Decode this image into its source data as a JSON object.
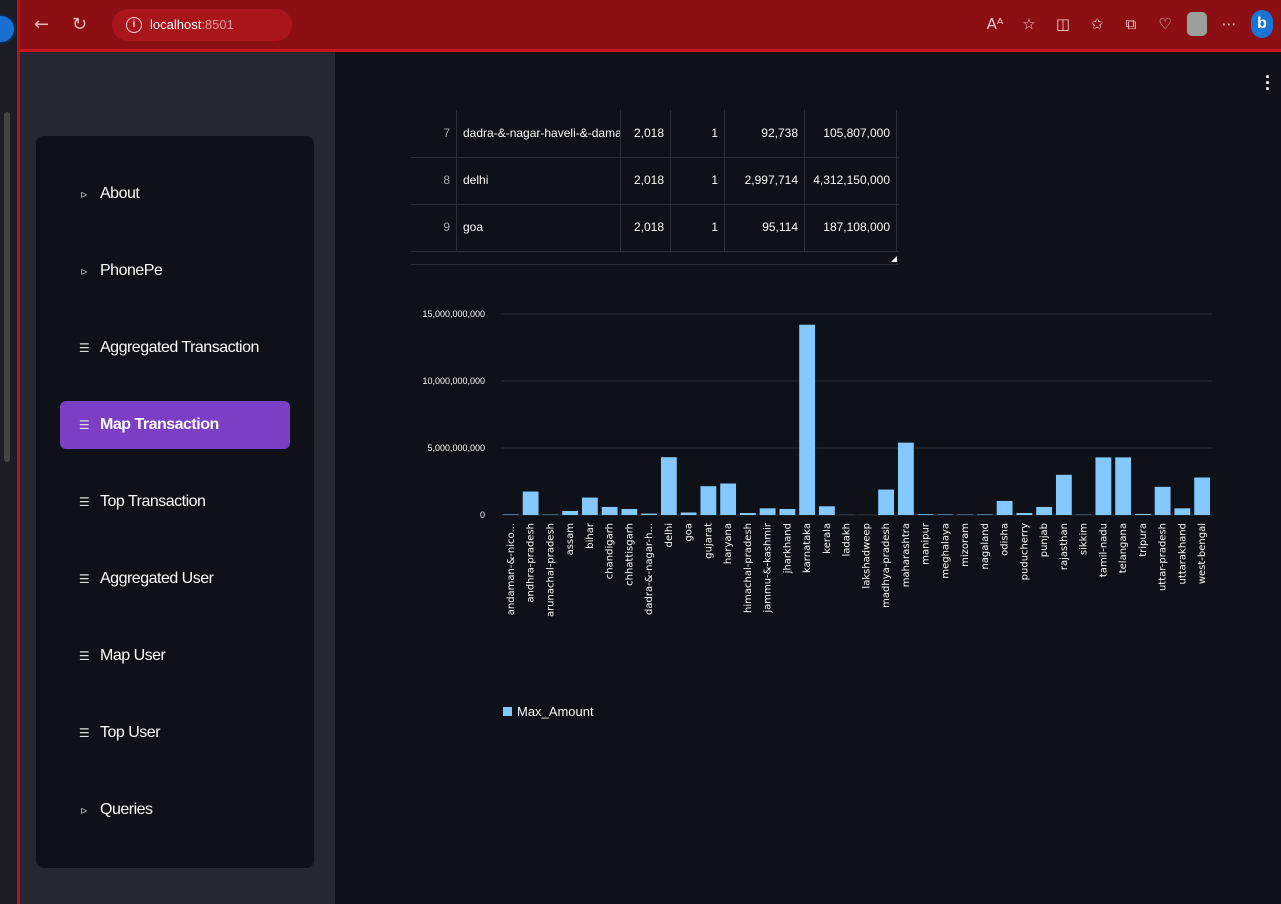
{
  "browser": {
    "url_host": "localhost",
    "url_port": ":8501",
    "icons": [
      "read-aloud-icon",
      "favorite-icon",
      "split-screen-icon",
      "favorites-icon",
      "collections-icon",
      "extensions-icon",
      "profile-avatar",
      "more-icon",
      "bing-icon"
    ]
  },
  "sidebar": {
    "items": [
      {
        "label": "About",
        "icon": "▹",
        "active": false
      },
      {
        "label": "PhonePe",
        "icon": "▹",
        "active": false
      },
      {
        "label": "Aggregated Transaction",
        "icon": "☰",
        "active": false
      },
      {
        "label": "Map Transaction",
        "icon": "☰",
        "active": true
      },
      {
        "label": "Top Transaction",
        "icon": "☰",
        "active": false
      },
      {
        "label": "Aggregated User",
        "icon": "☰",
        "active": false
      },
      {
        "label": "Map User",
        "icon": "☰",
        "active": false
      },
      {
        "label": "Top User",
        "icon": "☰",
        "active": false
      },
      {
        "label": "Queries",
        "icon": "▹",
        "active": false
      }
    ],
    "active_color": "#7b3fc5"
  },
  "table": {
    "rows": [
      {
        "index": "7",
        "state": "dadra-&-nagar-haveli-&-daman-&-diu",
        "year": "2,018",
        "quarter": "1",
        "count": "92,738",
        "amount": "105,807,000"
      },
      {
        "index": "8",
        "state": "delhi",
        "year": "2,018",
        "quarter": "1",
        "count": "2,997,714",
        "amount": "4,312,150,000"
      },
      {
        "index": "9",
        "state": "goa",
        "year": "2,018",
        "quarter": "1",
        "count": "95,114",
        "amount": "187,108,000"
      }
    ]
  },
  "chart_data": {
    "type": "bar",
    "categories": [
      "andaman-&-nico...",
      "andhra-pradesh",
      "arunachal-pradesh",
      "assam",
      "bihar",
      "chandigarh",
      "chhattisgarh",
      "dadra-&-nagar-h...",
      "delhi",
      "goa",
      "gujarat",
      "haryana",
      "himachal-pradesh",
      "jammu-&-kashmir",
      "jharkhand",
      "karnataka",
      "kerala",
      "ladakh",
      "lakshadweep",
      "madhya-pradesh",
      "maharashtra",
      "manipur",
      "meghalaya",
      "mizoram",
      "nagaland",
      "odisha",
      "puducherry",
      "punjab",
      "rajasthan",
      "sikkim",
      "tamil-nadu",
      "telangana",
      "tripura",
      "uttar-pradesh",
      "uttarakhand",
      "west-bengal"
    ],
    "series": [
      {
        "name": "Max_Amount",
        "values": [
          40000000,
          1750000000,
          30000000,
          300000000,
          1300000000,
          600000000,
          450000000,
          105807000,
          4312150000,
          187108000,
          2150000000,
          2350000000,
          150000000,
          500000000,
          450000000,
          14200000000,
          650000000,
          10000000,
          5000000,
          1900000000,
          5400000000,
          60000000,
          40000000,
          30000000,
          40000000,
          1050000000,
          150000000,
          600000000,
          3000000000,
          20000000,
          4300000000,
          4300000000,
          80000000,
          2100000000,
          500000000,
          2800000000
        ]
      }
    ],
    "ylim": [
      0,
      15000000000
    ],
    "yticks": [
      "0",
      "5,000,000,000",
      "10,000,000,000",
      "15,000,000,000"
    ],
    "ytick_values": [
      0,
      5000000000,
      10000000000,
      15000000000
    ],
    "bar_color": "#83c9ff",
    "grid": true,
    "legend": "bottom-left"
  }
}
